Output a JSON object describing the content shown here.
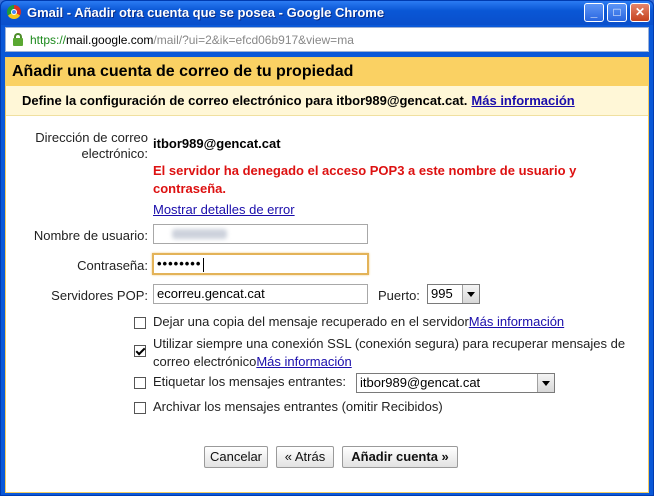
{
  "window": {
    "title": "Gmail - Añadir otra cuenta que se posea - Google Chrome",
    "controls": {
      "minimize": "_",
      "maximize": "□",
      "close": "✕"
    }
  },
  "address_bar": {
    "scheme": "https://",
    "host": "mail.google.com",
    "path": "/mail/?ui=2&ik=efcd06b917&view=ma"
  },
  "dialog": {
    "title": "Añadir una cuenta de correo de tu propiedad",
    "subtitle": "Define la configuración de correo electrónico para itbor989@gencat.cat.",
    "subtitle_link": "Más información",
    "email_label_1": "Dirección de correo",
    "email_label_2": "electrónico:",
    "email_value": "itbor989@gencat.cat",
    "error_line1": "El servidor ha denegado el acceso POP3 a este nombre de usuario y",
    "error_line2": "contraseña.",
    "error_details_link": "Mostrar detalles de error",
    "username_label": "Nombre de usuario:",
    "username_value": "",
    "password_label": "Contraseña:",
    "password_value": "••••••••",
    "pop_label": "Servidores POP:",
    "pop_value": "ecorreu.gencat.cat",
    "port_label": "Puerto:",
    "port_value": "995",
    "options": [
      {
        "text": "Dejar una copia del mensaje recuperado en el servidor",
        "link": "Más información",
        "checked": false
      },
      {
        "text_line1": "Utilizar siempre una conexión SSL (conexión segura) para recuperar mensajes de",
        "text_line2": "correo electrónico",
        "link": "Más información",
        "checked": true
      },
      {
        "text": "Etiquetar los mensajes entrantes:",
        "select_value": "itbor989@gencat.cat",
        "checked": false
      },
      {
        "text": "Archivar los mensajes entrantes (omitir Recibidos)",
        "checked": false
      }
    ],
    "buttons": {
      "cancel": "Cancelar",
      "back": "« Atrás",
      "add": "Añadir cuenta »"
    }
  },
  "colors": {
    "header": "#fad163",
    "subheader": "#fff7d7",
    "error": "#dd1111",
    "link": "#1a0dab"
  }
}
